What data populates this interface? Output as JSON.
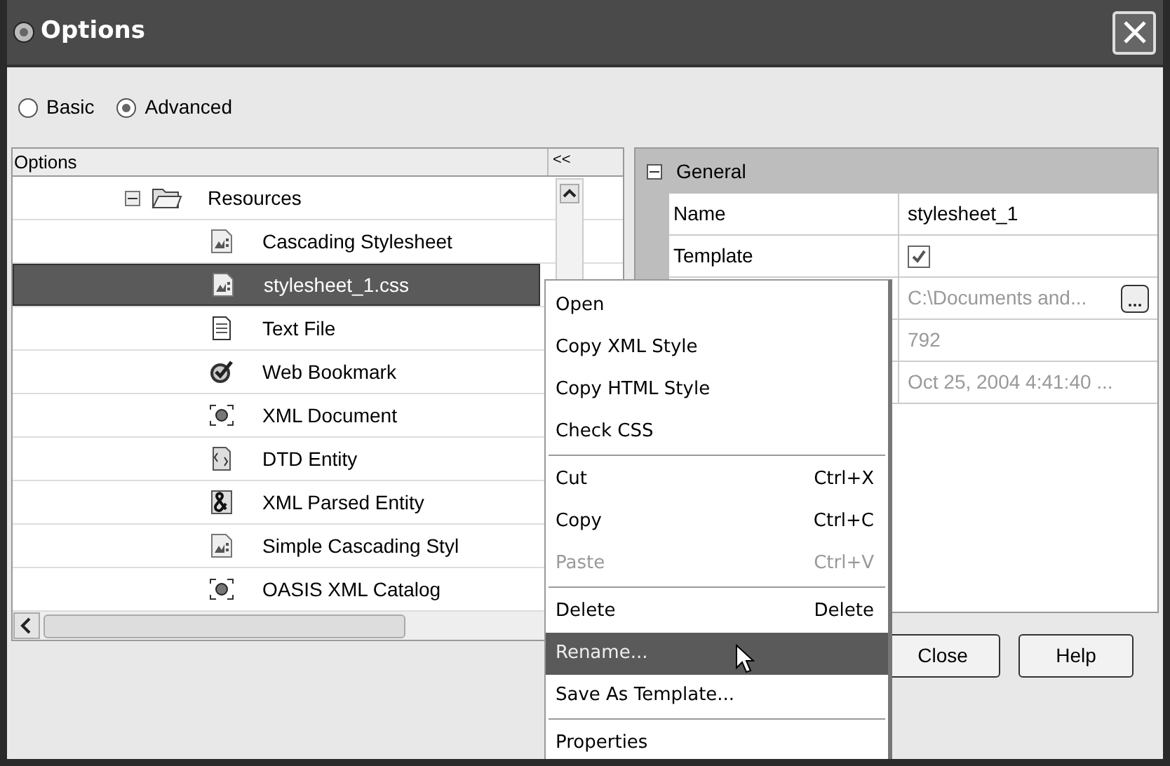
{
  "window": {
    "title": "Options"
  },
  "modes": [
    {
      "label": "Basic",
      "selected": false
    },
    {
      "label": "Advanced",
      "selected": true
    }
  ],
  "tree": {
    "header": "Options",
    "collapse_label": "<<",
    "items": [
      {
        "label": "Resources",
        "kind": "folder",
        "expanded": true,
        "selected": false,
        "children": [
          {
            "label": "Cascading Stylesheet",
            "kind": "css",
            "selected": false
          },
          {
            "label": "stylesheet_1.css",
            "kind": "css",
            "selected": true
          },
          {
            "label": "Text File",
            "kind": "text",
            "selected": false
          },
          {
            "label": "Web Bookmark",
            "kind": "bookmark",
            "selected": false
          },
          {
            "label": "XML Document",
            "kind": "xml",
            "selected": false
          },
          {
            "label": "DTD Entity",
            "kind": "dtd",
            "selected": false
          },
          {
            "label": "XML Parsed Entity",
            "kind": "entity",
            "selected": false
          },
          {
            "label": "Simple Cascading Styl",
            "kind": "css",
            "selected": false
          },
          {
            "label": "OASIS XML Catalog",
            "kind": "xml",
            "selected": false
          }
        ]
      }
    ]
  },
  "properties": {
    "section": "General",
    "expanded": true,
    "rows": [
      {
        "key": "Name",
        "kind": "text",
        "value": "stylesheet_1",
        "disabled": false
      },
      {
        "key": "Template",
        "kind": "checkbox",
        "checked": true
      },
      {
        "kind": "path",
        "value": "C:\\Documents and...",
        "disabled": true
      },
      {
        "kind": "text",
        "value": "792",
        "disabled": true
      },
      {
        "kind": "text",
        "value": "Oct 25, 2004 4:41:40 ...",
        "disabled": true
      }
    ]
  },
  "context_menu": [
    {
      "label": "Open",
      "disabled": false,
      "selected": false
    },
    {
      "label": "Copy XML Style",
      "disabled": false,
      "selected": false
    },
    {
      "label": "Copy HTML Style",
      "disabled": false,
      "selected": false
    },
    {
      "label": "Check CSS",
      "disabled": false,
      "selected": false
    },
    {
      "label": "Cut",
      "shortcut": "Ctrl+X",
      "separator_before": true,
      "disabled": false,
      "selected": false
    },
    {
      "label": "Copy",
      "shortcut": "Ctrl+C",
      "disabled": false,
      "selected": false
    },
    {
      "label": "Paste",
      "shortcut": "Ctrl+V",
      "disabled": true,
      "selected": false
    },
    {
      "label": "Delete",
      "shortcut": "Delete",
      "separator_before": true,
      "disabled": false,
      "selected": false
    },
    {
      "label": "Rename...",
      "disabled": false,
      "selected": true
    },
    {
      "label": "Save As Template...",
      "disabled": false,
      "selected": false
    },
    {
      "label": "Properties",
      "separator_before": true,
      "disabled": false,
      "selected": false
    }
  ],
  "buttons": [
    "Close",
    "Help"
  ]
}
